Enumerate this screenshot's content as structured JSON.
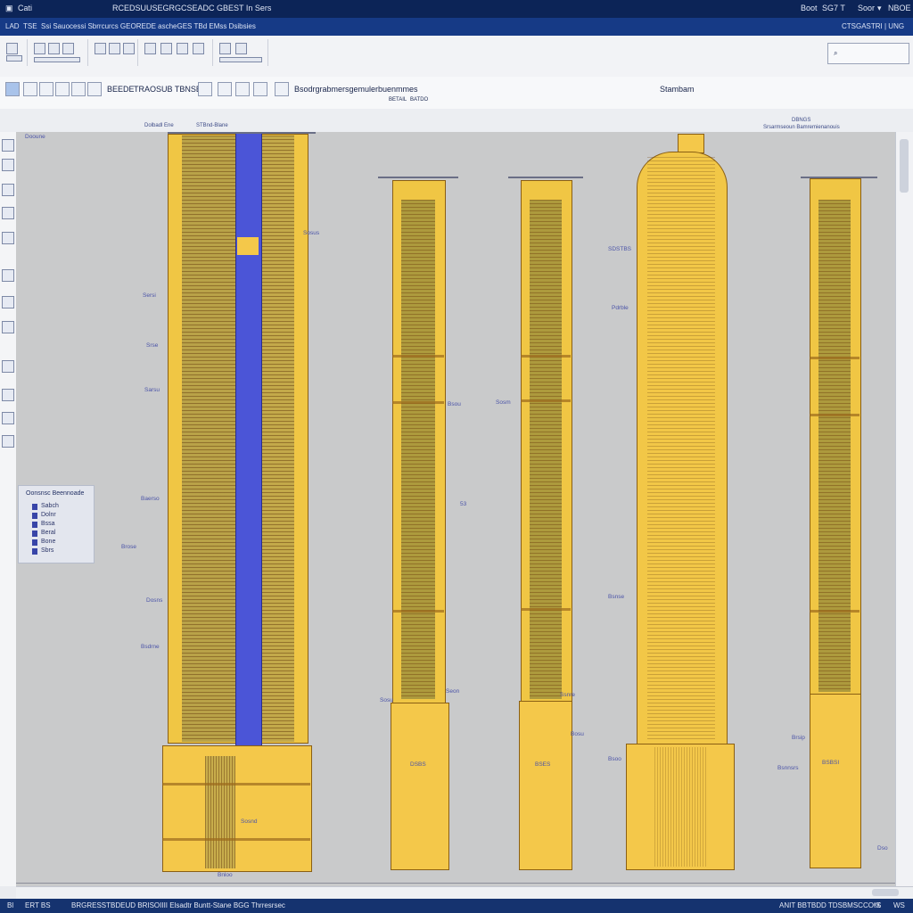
{
  "window": {
    "app_label": "Cati",
    "title": "RCEDSUUSEGRGCSEADC GBEST In Sers",
    "right_a": "Boot",
    "right_b": "SG7 T",
    "right_c": "Soor",
    "right_d": "NBOE"
  },
  "menubar": {
    "left_a": "LAD",
    "left_b": "TSE",
    "path": "Ssi Sauocessi   Sbrrcurcs GEOREDE ascheGES  TBd  EMss  Dsibsies",
    "right": "CTSGASTRI | UNG"
  },
  "toolbar": {
    "drop_label": "BEEDE",
    "field_label": "TRAOSUB TBNSE",
    "title": "Bsodrgrabmersgemulerbuenmmes",
    "view_label": "Stambam",
    "sub_a": "BETAIL",
    "sub_b": "BATDO"
  },
  "ruler": {
    "a": "Dolbadl Ene",
    "b": "STBnd-Blane",
    "c": "DBNGS",
    "d": "Srsarmseoun Bamremienanouis"
  },
  "legend": {
    "title": "Oonsnsc Beennoade",
    "items": [
      "Sabch",
      "Dolnr",
      "Bssa",
      "Beral",
      "Bone",
      "Sbrs"
    ]
  },
  "drawing_labels": {
    "c1_top": "Dooune",
    "c1_a": "Sersi",
    "c1_b": "Srse",
    "c1_c": "Sarsu",
    "c1_d": "Baerso",
    "c1_e": "Brose",
    "c1_f": "Dosns",
    "c1_g": "Bsdrne",
    "c1_h": "Sosnd",
    "c1_i": "Bnloo",
    "c1_r1": "Sosus",
    "c2_base": "DSBS",
    "c2_left": "Sosu",
    "c2_mid": "Seon",
    "c2_right": "Bsou",
    "c2_num": "53",
    "c3_base": "BSES",
    "c3_left": "Sosm",
    "c3_bot": "Bosu",
    "c4_a": "SDSTBS",
    "c4_b": "Pdrble",
    "c4_c": "Bsnse",
    "c4_d": "Bsoo",
    "c4_e": "Ssnre",
    "c5_a": "Brsip",
    "c5_b": "Bsnnsrs",
    "c5_c": "BSBSI",
    "c5_base": "Dso"
  },
  "status": {
    "left_a": "Bl",
    "left_b": "ERT BS",
    "middle": "BRGRESSTBDEUD BRISOIIII Elsadtr Buntt-Stane BGG  Thrresrsec",
    "right": "ANIT BBTBDD TDSBMSCCOIX",
    "coords": "WS",
    "zoom": "ᵒS"
  },
  "colors": {
    "title_bg": "#0c2457",
    "menu_bg": "#163a86",
    "status_bg": "#15336f",
    "canvas": "#c9cacb",
    "yellow": "#f4c84a",
    "olive": "#a6963d",
    "blue": "#4b55d7"
  }
}
